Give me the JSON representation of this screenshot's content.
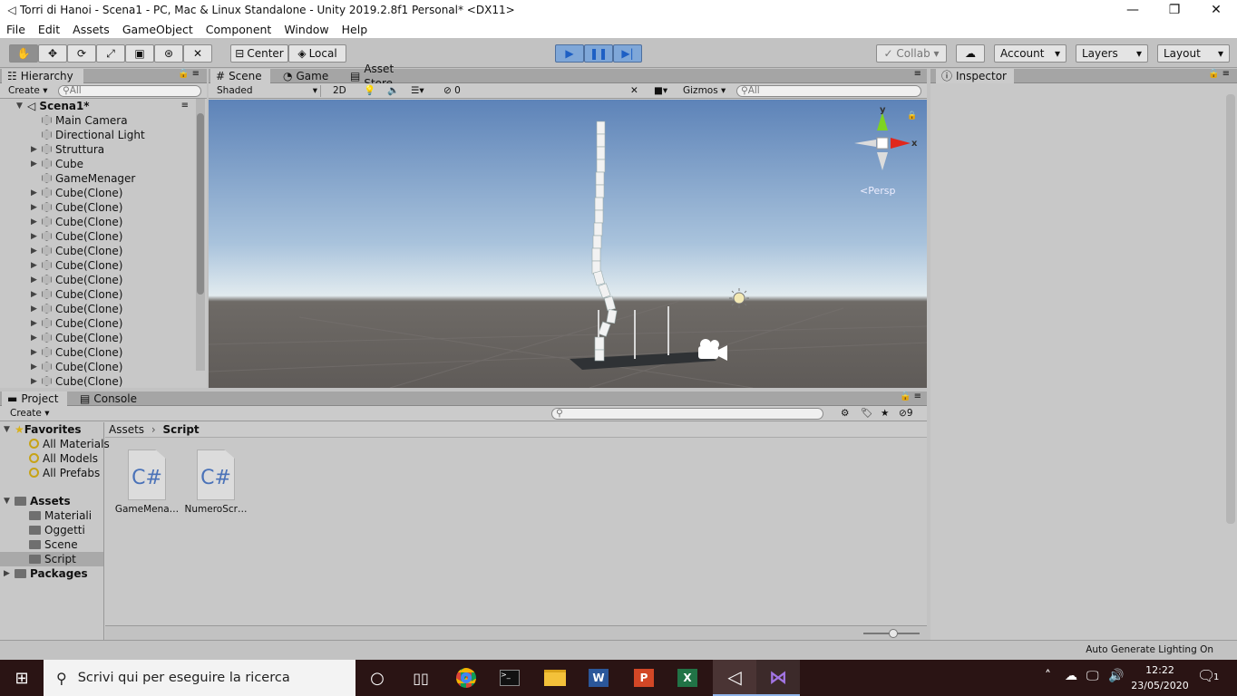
{
  "window": {
    "title": "Torri di Hanoi - Scena1 - PC, Mac & Linux Standalone - Unity 2019.2.8f1 Personal* <DX11>",
    "minimize_glyph": "—",
    "restore_glyph": "❐",
    "close_glyph": "✕"
  },
  "menu": [
    "File",
    "Edit",
    "Assets",
    "GameObject",
    "Component",
    "Window",
    "Help"
  ],
  "toolbar": {
    "pivot_label": "Center",
    "space_label": "Local",
    "collab_label": "Collab",
    "account_label": "Account",
    "layers_label": "Layers",
    "layout_label": "Layout",
    "accent_color": "#4d86d6"
  },
  "hierarchy": {
    "tab_label": "Hierarchy",
    "create_label": "Create",
    "search_placeholder": "All",
    "scene_name": "Scena1*",
    "items": [
      {
        "label": "Main Camera",
        "expandable": false
      },
      {
        "label": "Directional Light",
        "expandable": false
      },
      {
        "label": "Struttura",
        "expandable": true
      },
      {
        "label": "Cube",
        "expandable": true
      },
      {
        "label": "GameMenager",
        "expandable": false
      },
      {
        "label": "Cube(Clone)",
        "expandable": true
      },
      {
        "label": "Cube(Clone)",
        "expandable": true
      },
      {
        "label": "Cube(Clone)",
        "expandable": true
      },
      {
        "label": "Cube(Clone)",
        "expandable": true
      },
      {
        "label": "Cube(Clone)",
        "expandable": true
      },
      {
        "label": "Cube(Clone)",
        "expandable": true
      },
      {
        "label": "Cube(Clone)",
        "expandable": true
      },
      {
        "label": "Cube(Clone)",
        "expandable": true
      },
      {
        "label": "Cube(Clone)",
        "expandable": true
      },
      {
        "label": "Cube(Clone)",
        "expandable": true
      },
      {
        "label": "Cube(Clone)",
        "expandable": true
      },
      {
        "label": "Cube(Clone)",
        "expandable": true
      },
      {
        "label": "Cube(Clone)",
        "expandable": true
      },
      {
        "label": "Cube(Clone)",
        "expandable": true
      }
    ]
  },
  "scene_view": {
    "tabs": [
      "Scene",
      "Game",
      "Asset Store"
    ],
    "shading_mode": "Shaded",
    "mode_2d": "2D",
    "hidden_count": "0",
    "gizmos_label": "Gizmos",
    "search_placeholder": "All",
    "persp_label": "Persp",
    "axis_x": "x",
    "axis_y": "y"
  },
  "inspector": {
    "tab_label": "Inspector"
  },
  "project": {
    "tabs": [
      "Project",
      "Console"
    ],
    "create_label": "Create",
    "hidden_count": "9",
    "breadcrumb": [
      "Assets",
      "Script"
    ],
    "favorites_label": "Favorites",
    "favorites": [
      "All Materials",
      "All Models",
      "All Prefabs"
    ],
    "assets_label": "Assets",
    "asset_folders": [
      "Materiali",
      "Oggetti",
      "Scene",
      "Script"
    ],
    "selected_folder": "Script",
    "packages_label": "Packages",
    "files": [
      {
        "name": "GameMena…",
        "type": "C#"
      },
      {
        "name": "NumeroScr…",
        "type": "C#"
      }
    ]
  },
  "status_bar": {
    "right_text": "Auto Generate Lighting On"
  },
  "taskbar": {
    "search_placeholder": "Scrivi qui per eseguire la ricerca",
    "time": "12:22",
    "date": "23/05/2020",
    "notification_count": "1"
  }
}
